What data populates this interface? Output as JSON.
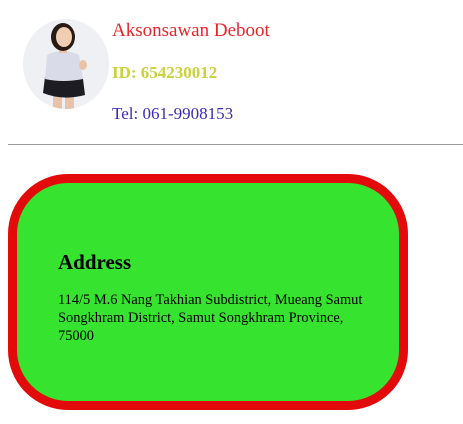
{
  "profile": {
    "name": "Aksonsawan Deboot",
    "student_id": "ID: 654230012",
    "tel": "Tel: 061-9908153"
  },
  "address": {
    "title": "Address",
    "text": "114/5 M.6 Nang Takhian Subdistrict, Mueang Samut Songkhram District, Samut Songkhram Province, 75000"
  },
  "colors": {
    "name": "#e8262a",
    "student_id": "#c9d23a",
    "tel": "#3a2bb8",
    "card_background": "#36e32e",
    "card_border": "#e20a0a"
  },
  "icons": {
    "avatar": "profile-photo"
  }
}
